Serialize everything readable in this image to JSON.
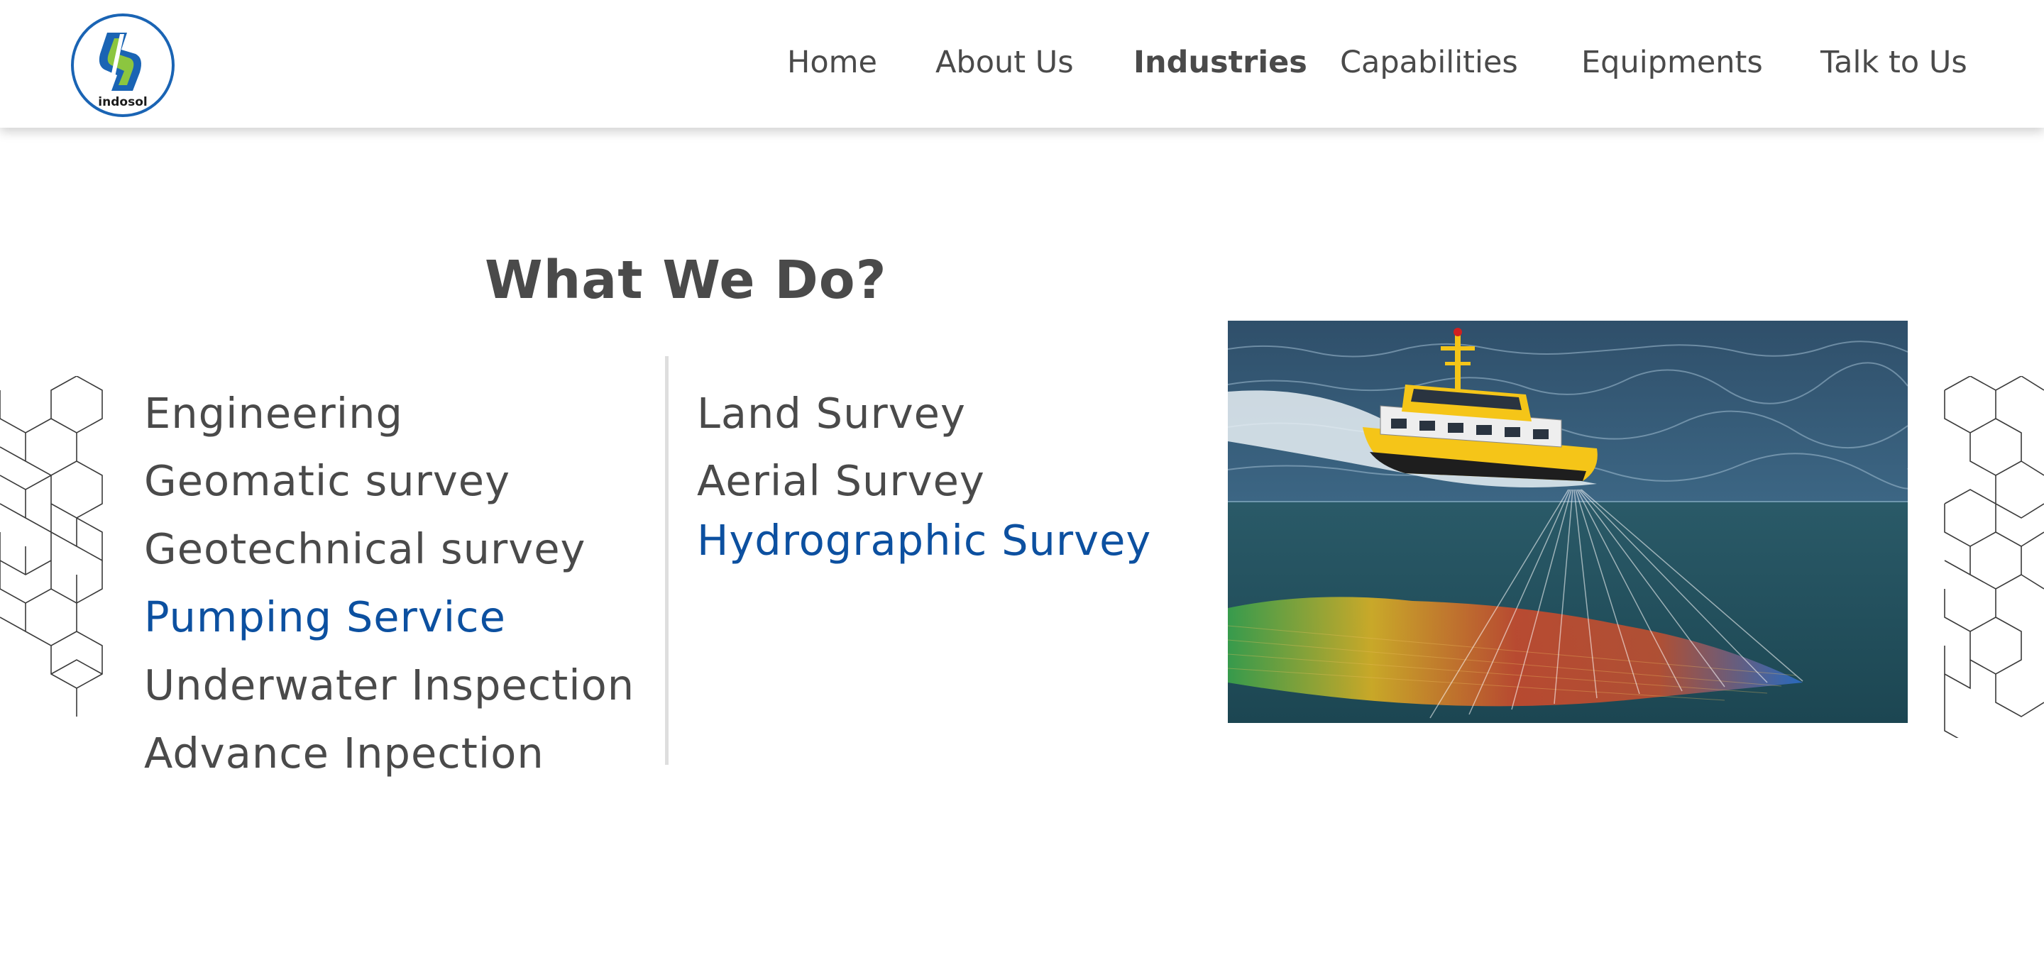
{
  "header": {
    "logo": {
      "text": "indosol",
      "icon": "indosol-logo"
    },
    "nav": [
      {
        "label": "Home",
        "active": false
      },
      {
        "label": "About Us",
        "active": false
      },
      {
        "label": "Industries",
        "active": true
      },
      {
        "label": "Capabilities",
        "active": false
      },
      {
        "label": "Equipments",
        "active": false
      },
      {
        "label": "Talk to Us",
        "active": false
      }
    ]
  },
  "main": {
    "title": "What We Do?",
    "left_services": [
      {
        "label": "Engineering",
        "highlighted": false
      },
      {
        "label": "Geomatic survey",
        "highlighted": false
      },
      {
        "label": "Geotechnical survey",
        "highlighted": false
      },
      {
        "label": "Pumping Service",
        "highlighted": true
      },
      {
        "label": "Underwater Inspection",
        "highlighted": false
      },
      {
        "label": "Advance Inpection",
        "highlighted": false
      }
    ],
    "right_services": [
      {
        "label": "Land Survey",
        "highlighted": false
      },
      {
        "label": "Aerial Survey",
        "highlighted": false
      },
      {
        "label": "Hydrographic Survey",
        "highlighted": true
      }
    ],
    "hero_image": "hydrographic-survey-boat-sonar"
  },
  "colors": {
    "text": "#4a4a4a",
    "highlight": "#0c50a0",
    "logo_blue": "#1a64b4",
    "logo_green": "#8cc63f",
    "boat_yellow": "#f5c518",
    "sea": "#23505f"
  }
}
